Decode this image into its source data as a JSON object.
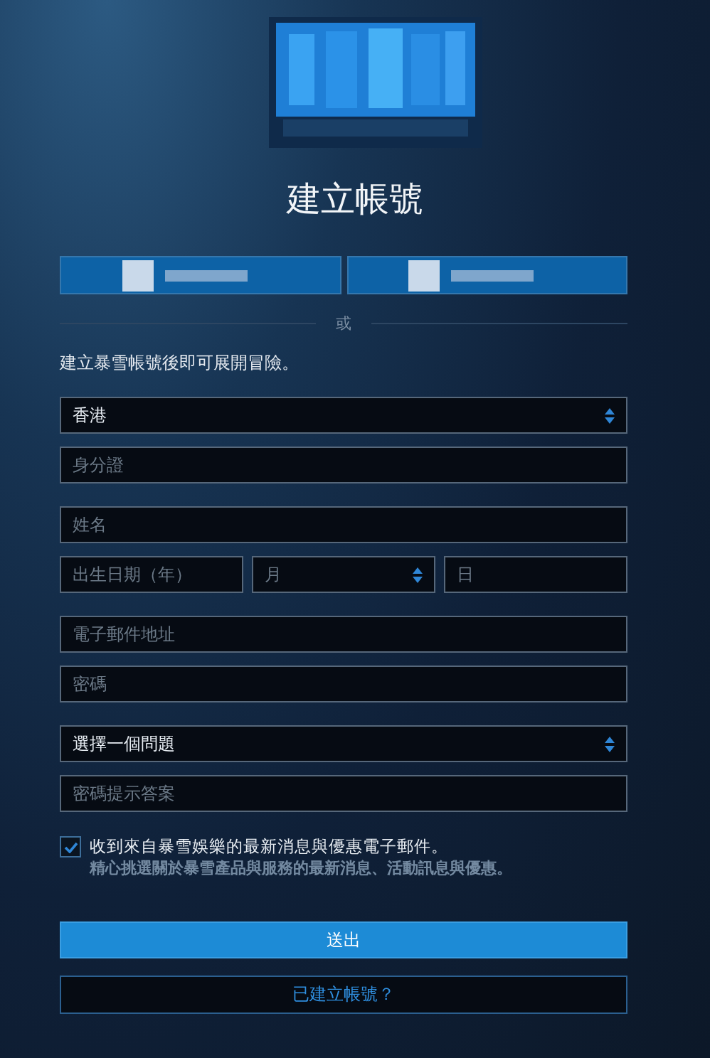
{
  "logo": {
    "kind": "picture"
  },
  "title": "建立帳號",
  "social_buttons": [
    {
      "kind": "pixelated"
    },
    {
      "kind": "pixelated"
    }
  ],
  "divider_text": "或",
  "intro": "建立暴雪帳號後即可展開冒險。",
  "field_groups": [
    [
      {
        "kind": "select",
        "value": "香港"
      },
      {
        "kind": "input",
        "placeholder": "身分證"
      }
    ],
    [
      {
        "kind": "input",
        "placeholder": "姓名"
      },
      {
        "kind": "row",
        "items": [
          {
            "kind": "input",
            "placeholder": "出生日期（年）"
          },
          {
            "kind": "select",
            "placeholder": "月"
          },
          {
            "kind": "input",
            "placeholder": "日"
          }
        ]
      }
    ],
    [
      {
        "kind": "input",
        "placeholder": "電子郵件地址"
      },
      {
        "kind": "input",
        "placeholder": "密碼"
      }
    ],
    [
      {
        "kind": "select",
        "value": "選擇一個問題"
      },
      {
        "kind": "input",
        "placeholder": "密碼提示答案"
      }
    ]
  ],
  "newsletter": {
    "checked": true,
    "label": "收到來自暴雪娛樂的最新消息與優惠電子郵件。",
    "note": "精心挑選關於暴雪產品與服務的最新消息、活動訊息與優惠。"
  },
  "submit": "送出",
  "login_link": "已建立帳號？"
}
